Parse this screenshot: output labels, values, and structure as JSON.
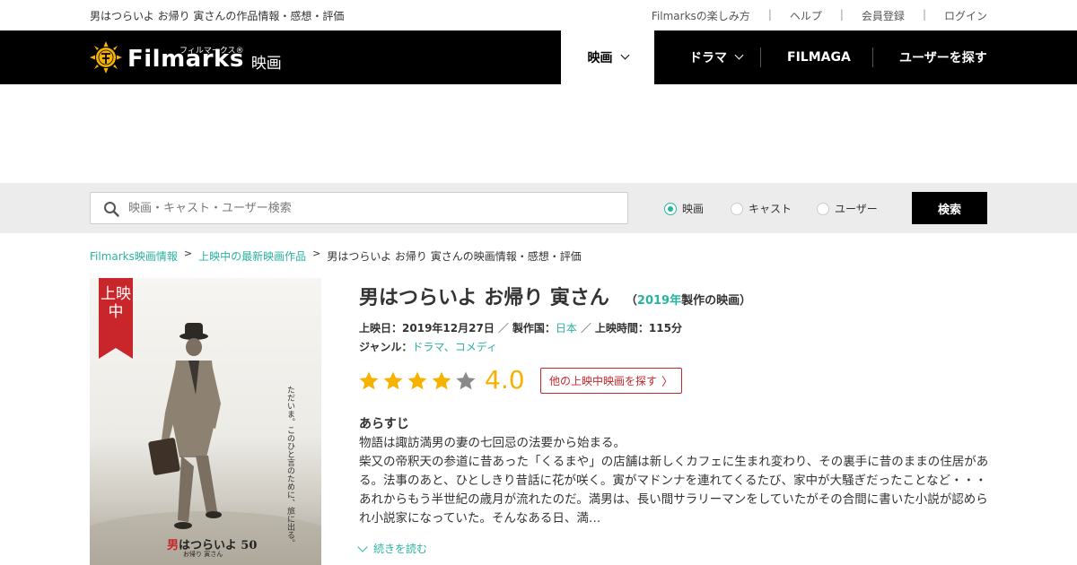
{
  "topbar": {
    "page_desc": "男はつらいよ お帰り 寅さんの作品情報・感想・評価",
    "links": [
      "Filmarksの楽しみ方",
      "ヘルプ",
      "会員登録",
      "ログイン"
    ]
  },
  "header": {
    "logo_word": "Filmarks",
    "logo_kana": "フィルマークス",
    "logo_sub": "映画",
    "nav": {
      "movie": "映画",
      "drama": "ドラマ",
      "filmaga": "FILMAGA",
      "users": "ユーザーを探す"
    }
  },
  "search": {
    "placeholder": "映画・キャスト・ユーザー検索",
    "options": [
      "映画",
      "キャスト",
      "ユーザー"
    ],
    "selected": "映画",
    "button": "検索"
  },
  "breadcrumb": {
    "items": [
      "Filmarks映画情報",
      "上映中の最新映画作品"
    ],
    "current": "男はつらいよ お帰り 寅さんの映画情報・感想・評価"
  },
  "poster": {
    "ribbon": "上映中",
    "vertical_copy": "ただいま。このひと言のために、旅に出る。",
    "title_red": "男",
    "title_rest": "はつらいよ 50",
    "subtitle": "お帰り 寅さん"
  },
  "movie": {
    "title": "男はつらいよ お帰り 寅さん",
    "year": "2019年",
    "year_suffix": "製作の映画）",
    "year_prefix": "（",
    "release_label": "上映日：",
    "release": "2019年12月27日",
    "country_label": "製作国：",
    "country": "日本",
    "runtime_label": "上映時間：",
    "runtime": "115分",
    "genre_label": "ジャンル：",
    "genres": "ドラマ、コメディ",
    "score": "4.0",
    "rating": 4.0,
    "other_button": "他の上映中映画を探す"
  },
  "synopsis": {
    "heading": "あらすじ",
    "text": "物語は諏訪満男の妻の七回忌の法要から始まる。\n柴又の帝釈天の参道に昔あった「くるまや」の店舗は新しくカフェに生まれ変わり、その裏手に昔のままの住居がある。法事のあと、ひとしきり昔話に花が咲く。寅がマドンナを連れてくるたび、家中が大騒ぎだったことなど・・・あれからもう半世紀の歳月が流れたのだ。満男は、長い間サラリーマンをしていたがその合間に書いた小説が認められ小説家になっていた。そんなある日、満…",
    "read_more": "続きを読む"
  },
  "colors": {
    "accent": "#2bb3a1",
    "star": "#f5b300",
    "red": "#c9262c",
    "header_bg": "#000000"
  }
}
